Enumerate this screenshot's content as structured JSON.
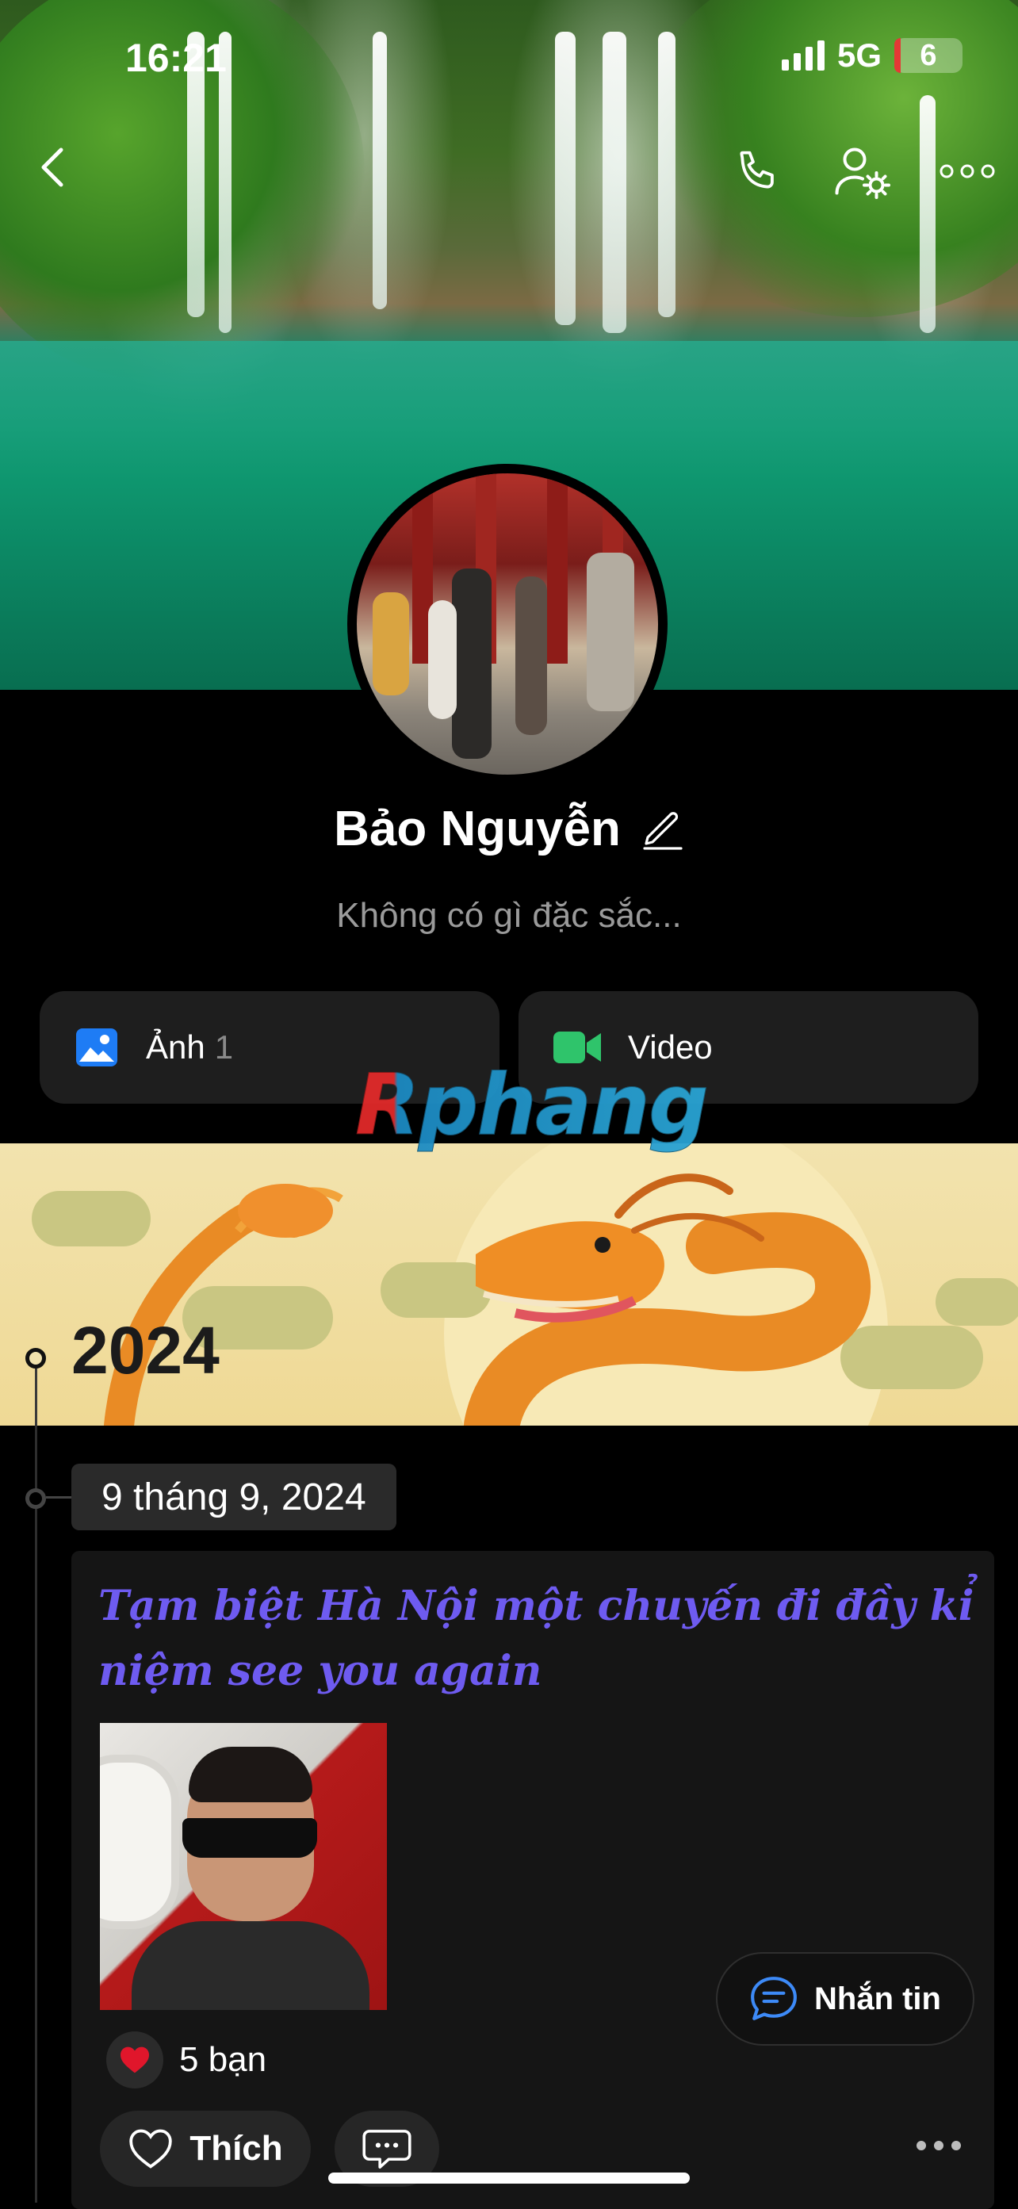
{
  "status_bar": {
    "time": "16:21",
    "network": "5G",
    "battery": "6"
  },
  "profile": {
    "name": "Bảo Nguyễn",
    "bio": "Không có gì đặc sắc..."
  },
  "media_buttons": [
    {
      "label": "Ảnh",
      "count": "1",
      "icon": "photo-icon",
      "icon_color": "#1e7cf5"
    },
    {
      "label": "Video",
      "icon": "video-camera-icon",
      "icon_color": "#2fc46b"
    }
  ],
  "watermark": "Rphang",
  "timeline": {
    "year": "2024",
    "date": "9 tháng 9, 2024"
  },
  "post": {
    "text": "Tạm biệt Hà Nội một chuyến đi đầy kỉ niệm see you again",
    "text_color": "#6e5bf0",
    "reactions_label": "5 bạn",
    "like_label": "Thích"
  },
  "message_button": {
    "label": "Nhắn tin",
    "icon_color": "#3d8af7"
  }
}
